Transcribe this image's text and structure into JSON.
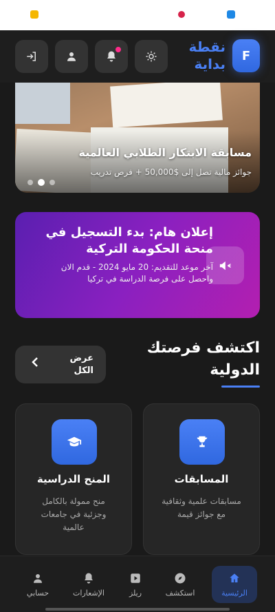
{
  "header": {
    "logo_letter": "F",
    "brand_line1": "نقطة",
    "brand_line2": "بداية"
  },
  "carousel": {
    "title": "مسابقة الابتكار الطلابي العالمية",
    "subtitle": "جوائز مالية تصل إلى $50,000 + فرص تدريب",
    "active_index": 1,
    "slide_count": 3
  },
  "announcement": {
    "title": "إعلان هام: بدء التسجيل في منحة الحكومة التركية",
    "body": "آخر موعد للتقديم: 20 مايو 2024 - قدم الان واحصل على فرصة الدراسة في تركيا"
  },
  "discover": {
    "title": "اكتشف فرصتك الدولية",
    "view_all": "عرض الكل"
  },
  "cards": [
    {
      "title": "المسابقات",
      "desc": "مسابقات علمية وثقافية مع جوائز قيمة",
      "icon": "trophy-icon"
    },
    {
      "title": "المنح الدراسية",
      "desc": "منح ممولة بالكامل وجزئية في جامعات عالمية",
      "icon": "graduation-cap-icon"
    }
  ],
  "nav": {
    "home": "الرئيسية",
    "explore": "استكشف",
    "reels": "ريلز",
    "notifications": "الإشعارات",
    "account": "حسابي"
  },
  "colors": {
    "accent": "#4a80f5",
    "notification_dot": "#ff2b8a",
    "announcement_gradient_start": "#5a1fb0",
    "announcement_gradient_end": "#b31fb0"
  }
}
